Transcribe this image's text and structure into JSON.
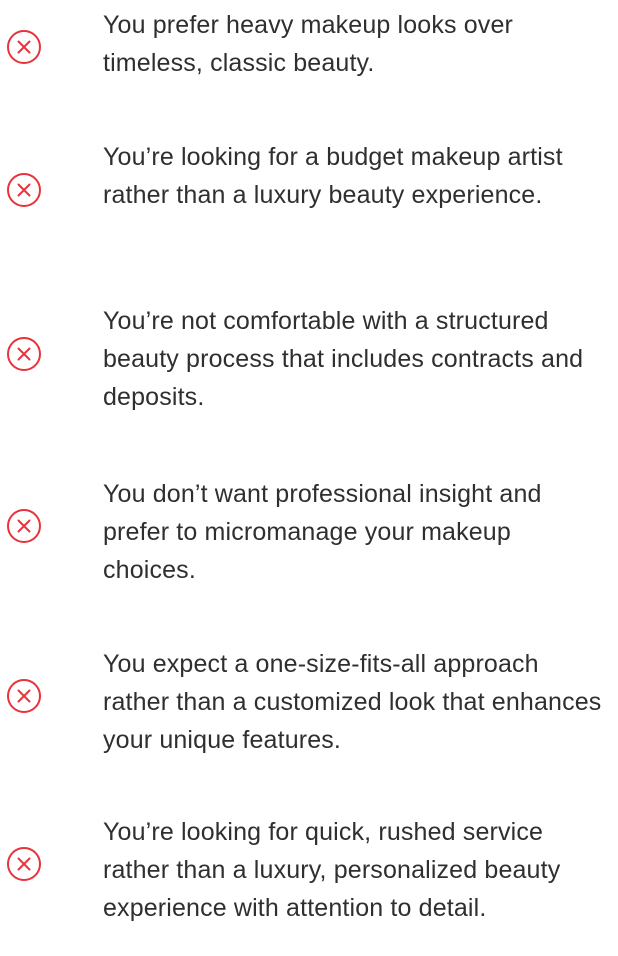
{
  "reasons": {
    "icon": "circle-x-icon",
    "icon_color": "#e8323c",
    "text_color": "#2f2f2f",
    "items": [
      {
        "text": "You prefer heavy makeup looks over timeless, classic beauty."
      },
      {
        "text": "You’re looking for a budget makeup artist rather than a luxury beauty experience."
      },
      {
        "text": "You’re not comfortable with a structured beauty process that includes contracts and deposits."
      },
      {
        "text": "You don’t want professional insight and prefer to micromanage your makeup choices."
      },
      {
        "text": "You expect a one-size-fits-all approach rather than a customized look that enhances your unique features."
      },
      {
        "text": "You’re looking for quick, rushed service rather than a luxury, personalized beauty experience with attention to detail."
      }
    ]
  }
}
